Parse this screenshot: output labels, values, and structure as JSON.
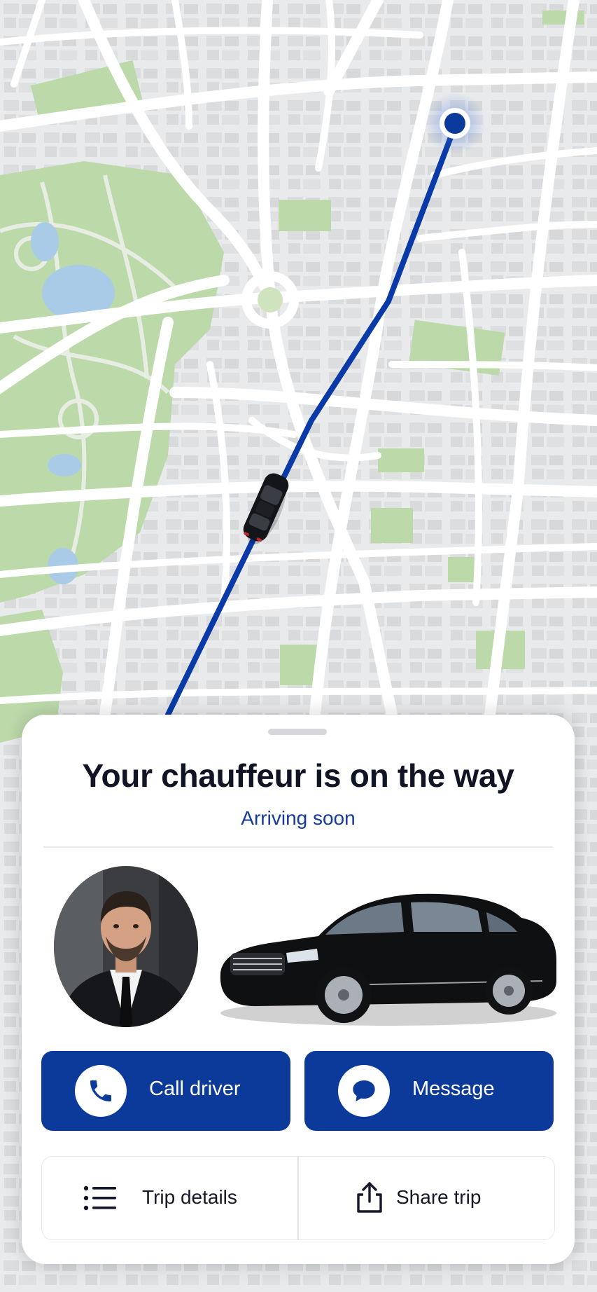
{
  "sheet": {
    "title": "Your chauffeur is on the way",
    "subtitle": "Arriving soon"
  },
  "actions": {
    "call_label": "Call driver",
    "message_label": "Message"
  },
  "secondary": {
    "trip_details_label": "Trip details",
    "share_trip_label": "Share trip"
  },
  "icons": {
    "call": "phone-icon",
    "message": "chat-bubble-icon",
    "trip_details": "list-icon",
    "share": "share-icon"
  },
  "colors": {
    "primary": "#0b3a9a",
    "route": "#0a3aa8",
    "subtitle": "#143a9c",
    "park": "#b9d9a5",
    "water": "#a7cbea"
  }
}
